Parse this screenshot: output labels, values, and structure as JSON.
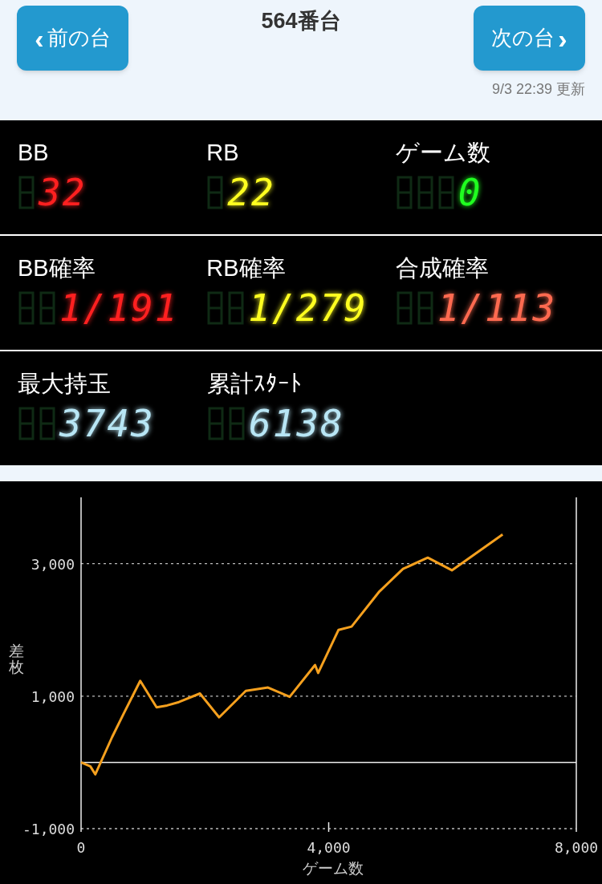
{
  "header": {
    "prev_button": {
      "arrow": "‹",
      "label": "前の台"
    },
    "title": "564番台",
    "next_button": {
      "label": "次の台",
      "arrow": "›"
    },
    "updated": "9/3 22:39 更新"
  },
  "stats": [
    [
      {
        "label": "BB",
        "value": "32",
        "color": "#ff2020"
      },
      {
        "label": "RB",
        "value": "22",
        "color": "#ffff20"
      },
      {
        "label": "ゲーム数",
        "value": "0",
        "color": "#20ff20"
      }
    ],
    [
      {
        "label": "BB確率",
        "value": "1/191",
        "color": "#ff2020"
      },
      {
        "label": "RB確率",
        "value": "1/279",
        "color": "#ffff20"
      },
      {
        "label": "合成確率",
        "value": "1/113",
        "color": "#ff6a50"
      }
    ],
    [
      {
        "label": "最大持玉",
        "value": "3743",
        "color": "#b8e6f5"
      },
      {
        "label": "累計ｽﾀｰﾄ",
        "value": "6138",
        "color": "#b8e6f5"
      }
    ]
  ],
  "chart_data": {
    "type": "line",
    "xlabel": "ゲーム数",
    "ylabel": "差枚",
    "x": [
      0,
      150,
      230,
      500,
      690,
      955,
      1220,
      1390,
      1580,
      1920,
      2230,
      2660,
      3020,
      3370,
      3780,
      3830,
      4160,
      4370,
      4820,
      5200,
      5600,
      5990,
      6810
    ],
    "series": [
      {
        "color": "#f5a01e",
        "values": [
          0,
          -60,
          -180,
          380,
          740,
          1230,
          830,
          860,
          910,
          1040,
          680,
          1080,
          1130,
          990,
          1470,
          1350,
          2000,
          2050,
          2580,
          2920,
          3090,
          2900,
          3440
        ]
      }
    ],
    "xlim": [
      0,
      8000
    ],
    "ylim": [
      -1000,
      4000
    ],
    "xticks": [
      {
        "value": 0,
        "label": "0"
      },
      {
        "value": 4000,
        "label": "4,000"
      },
      {
        "value": 8000,
        "label": "8,000"
      }
    ],
    "yticks": [
      {
        "value": -1000,
        "label": "-1,000"
      },
      {
        "value": 1000,
        "label": "1,000"
      },
      {
        "value": 3000,
        "label": "3,000"
      }
    ]
  }
}
